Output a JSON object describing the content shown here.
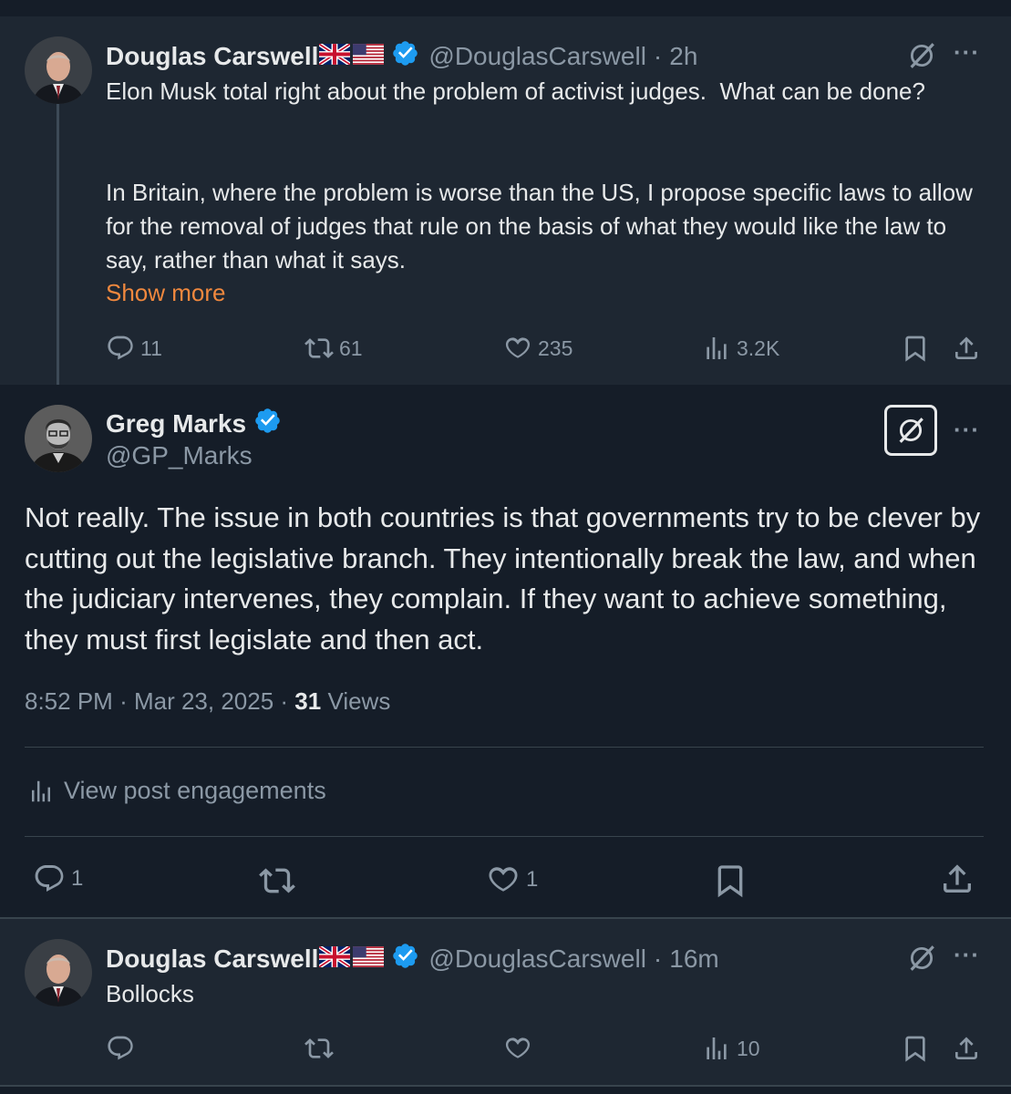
{
  "post1": {
    "author_name": "Douglas Carswell",
    "flags": "🇬🇧🇺🇸",
    "handle": "@DouglasCarswell",
    "time": "2h",
    "text_line1": "Elon Musk total right about the problem of activist judges.  What can be done?",
    "text_para2": "In Britain, where the problem is worse than the US, I propose specific laws to allow for the removal of judges that rule on the basis of what they would like the law to say, rather than what it says.",
    "show_more": "Show more",
    "replies": "11",
    "reposts": "61",
    "likes": "235",
    "views": "3.2K"
  },
  "post2": {
    "author_name": "Greg Marks",
    "handle": "@GP_Marks",
    "text": "Not really. The issue in both countries is that governments try to be clever by cutting out the legislative branch. They intentionally break the law, and when the judiciary intervenes, they complain. If they want to achieve something, they must first legislate and then act.",
    "time": "8:52 PM",
    "date": "Mar 23, 2025",
    "views_count": "31",
    "views_label": "Views",
    "engagements_label": "View post engagements",
    "replies": "1",
    "likes": "1"
  },
  "post3": {
    "author_name": "Douglas Carswell",
    "flags": "🇬🇧🇺🇸",
    "handle": "@DouglasCarswell",
    "time": "16m",
    "text": "Bollocks",
    "views": "10"
  },
  "icons": [
    "reply-icon",
    "repost-icon",
    "like-icon",
    "views-icon",
    "bookmark-icon",
    "share-icon",
    "grok-icon",
    "more-icon",
    "verified-icon"
  ],
  "colors": {
    "background": "#151d28",
    "highlight_background": "#1e2732",
    "text": "#e7e9ea",
    "muted": "#8b98a5",
    "verified": "#1d9bf0",
    "show_more": "#f0883e"
  }
}
